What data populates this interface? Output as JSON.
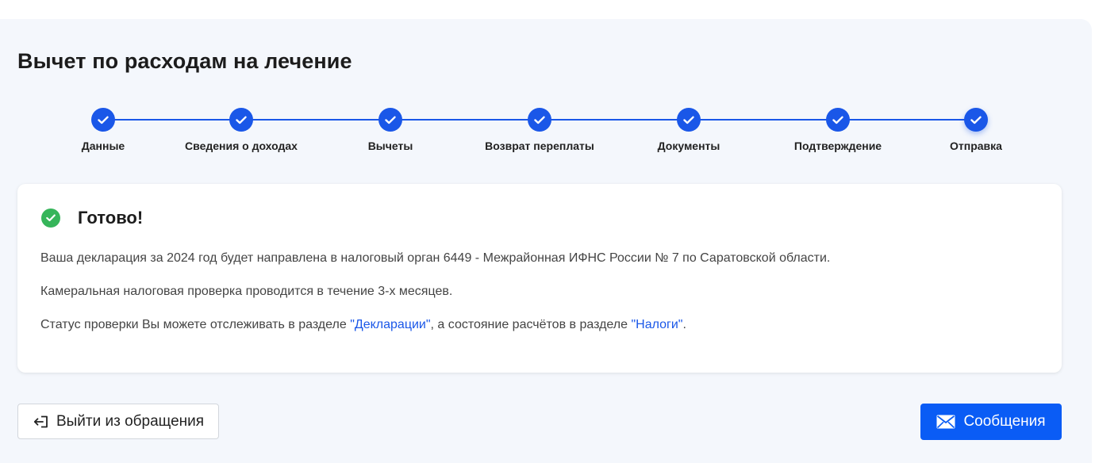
{
  "page": {
    "title": "Вычет по расходам на лечение"
  },
  "stepper": {
    "steps": [
      {
        "label": "Данные",
        "icon": "check-icon",
        "status": "done"
      },
      {
        "label": "Сведения о доходах",
        "icon": "check-icon",
        "status": "done"
      },
      {
        "label": "Вычеты",
        "icon": "check-icon",
        "status": "done"
      },
      {
        "label": "Возврат переплаты",
        "icon": "check-icon",
        "status": "done"
      },
      {
        "label": "Документы",
        "icon": "check-icon",
        "status": "done"
      },
      {
        "label": "Подтверждение",
        "icon": "check-icon",
        "status": "done"
      },
      {
        "label": "Отправка",
        "icon": "check-icon",
        "status": "current"
      }
    ]
  },
  "result": {
    "icon": "success-check-icon",
    "title": "Готово!",
    "line1": "Ваша декларация за 2024 год будет направлена в налоговый орган 6449 - Межрайонная ИФНС России № 7 по Саратовской области.",
    "line2": "Камеральная налоговая проверка проводится в течение 3-х месяцев.",
    "line3": {
      "prefix": "Статус проверки Вы можете отслеживать в разделе ",
      "link1": "\"Декларации\"",
      "middle": ", а состояние расчётов в разделе ",
      "link2": "\"Налоги\"",
      "suffix": "."
    }
  },
  "actions": {
    "exit_label": "Выйти из обращения",
    "exit_icon": "exit-icon",
    "messages_label": "Сообщения",
    "messages_icon": "envelope-icon"
  },
  "colors": {
    "accent": "#1a57e8",
    "button_primary": "#0a5cf5",
    "success": "#36b55a",
    "panel_background": "#f4f7fc"
  }
}
